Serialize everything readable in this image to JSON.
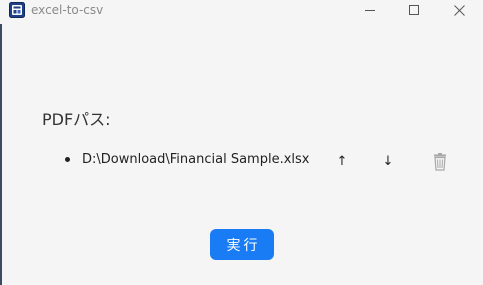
{
  "window": {
    "title": "excel-to-csv",
    "app_icon": "app-icon",
    "controls": {
      "minimize_icon": "minimize-icon",
      "maximize_icon": "maximize-icon",
      "close_icon": "close-icon"
    }
  },
  "main": {
    "pdf_label": "PDFパス:",
    "files": [
      {
        "path": "D:\\Download\\Financial Sample.xlsx",
        "move_up_label": "↑",
        "move_down_label": "↓",
        "delete_icon": "trash-icon"
      }
    ],
    "run_label": "実行"
  },
  "colors": {
    "window_background": "#f5f5f5",
    "title_text": "#8a8a8a",
    "accent": "#1a7cf5",
    "text": "#222222",
    "trash_icon": "#a8a8a8"
  }
}
